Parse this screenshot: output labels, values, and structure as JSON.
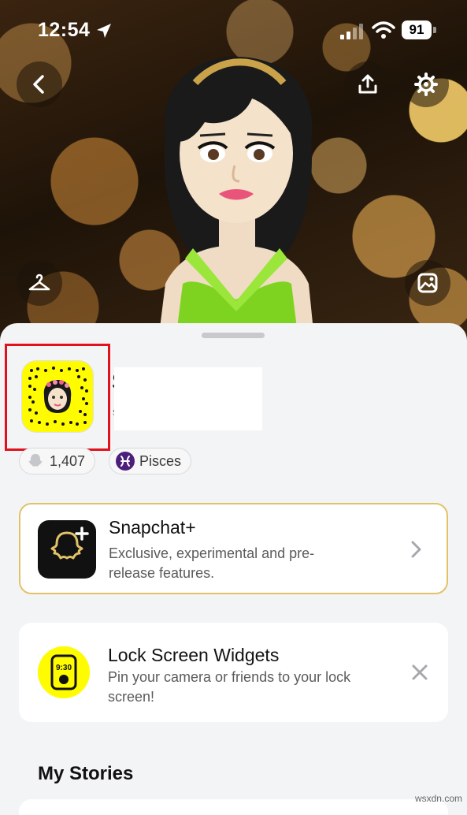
{
  "status_bar": {
    "time": "12:54",
    "battery": "91",
    "icons": [
      "location-arrow-icon",
      "signal-icon",
      "wifi-icon",
      "battery-icon"
    ]
  },
  "hero": {
    "buttons": [
      "back-icon",
      "share-icon",
      "gear-icon",
      "hanger-icon",
      "image-icon"
    ]
  },
  "profile": {
    "display_name_peek": "S",
    "username_peek": "s",
    "snapscore": "1,407",
    "zodiac": "Pisces"
  },
  "snapchat_plus": {
    "title": "Snapchat+",
    "description_line1": "Exclusive, experimental and pre-",
    "description_line2": "release features."
  },
  "lock_widgets": {
    "title": "Lock Screen Widgets",
    "description_line1": "Pin your camera or friends to your lock",
    "description_line2": "screen!",
    "icon_time": "9:30"
  },
  "my_stories": {
    "title": "My Stories"
  },
  "watermark": "wsxdn.com",
  "colors": {
    "snap_yellow": "#fffc00",
    "highlight_red": "#e0121b",
    "plus_gold": "#e2c268",
    "pisces_purple": "#4b1f7a"
  }
}
